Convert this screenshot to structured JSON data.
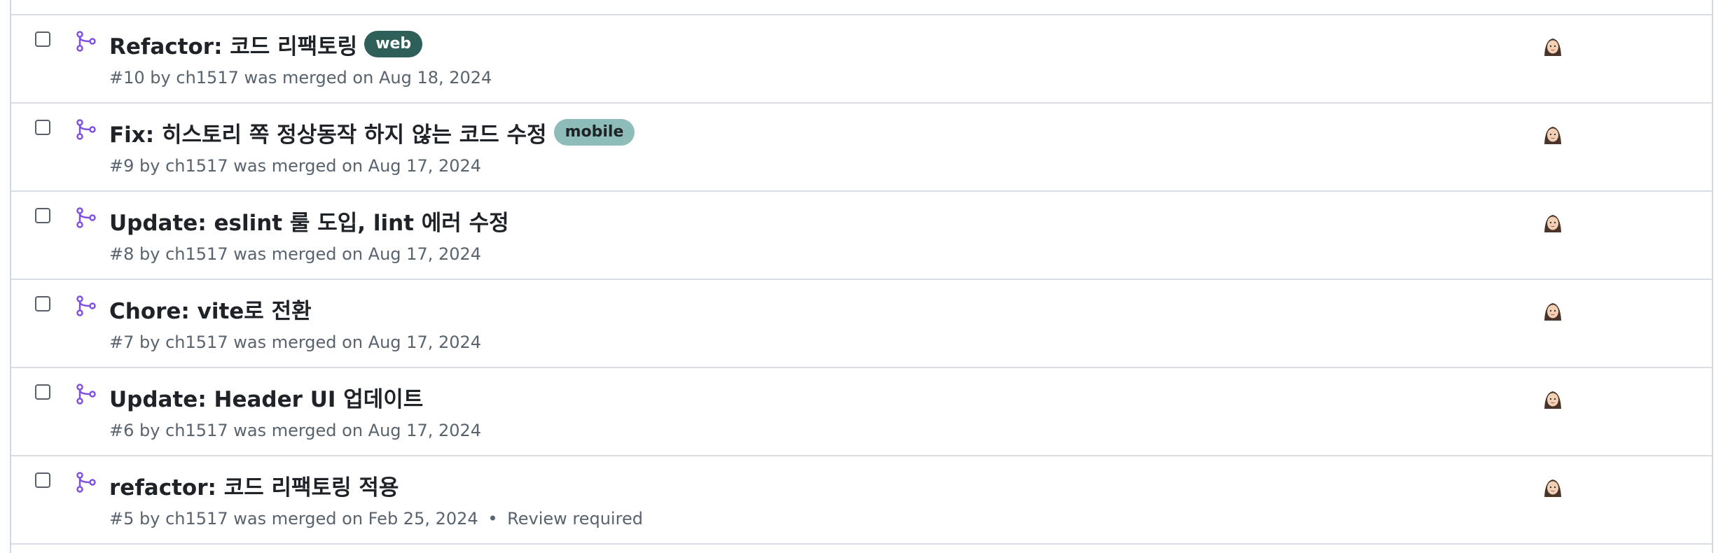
{
  "colors": {
    "accent_merged": "#8250df",
    "meta_text": "#59636e",
    "border": "#d8dee4"
  },
  "pull_requests": [
    {
      "title": "Refactor: 코드 리팩토링",
      "label": {
        "text": "web",
        "bg": "#2e5f59",
        "fg": "#ffffff"
      },
      "number": "#10",
      "by": "by",
      "author": "ch1517",
      "status": "was merged on Aug 18, 2024",
      "extra": ""
    },
    {
      "title": "Fix: 히스토리 쪽 정상동작 하지 않는 코드 수정",
      "label": {
        "text": "mobile",
        "bg": "#8dbcb9",
        "fg": "#1f2328"
      },
      "number": "#9",
      "by": "by",
      "author": "ch1517",
      "status": "was merged on Aug 17, 2024",
      "extra": ""
    },
    {
      "title": "Update: eslint 룰 도입, lint 에러 수정",
      "label": null,
      "number": "#8",
      "by": "by",
      "author": "ch1517",
      "status": "was merged on Aug 17, 2024",
      "extra": ""
    },
    {
      "title": "Chore: vite로 전환",
      "label": null,
      "number": "#7",
      "by": "by",
      "author": "ch1517",
      "status": "was merged on Aug 17, 2024",
      "extra": ""
    },
    {
      "title": "Update: Header UI 업데이트",
      "label": null,
      "number": "#6",
      "by": "by",
      "author": "ch1517",
      "status": "was merged on Aug 17, 2024",
      "extra": ""
    },
    {
      "title": "refactor: 코드 리팩토링 적용",
      "label": null,
      "number": "#5",
      "by": "by",
      "author": "ch1517",
      "status": "was merged on Feb 25, 2024",
      "extra": "Review required"
    }
  ],
  "icons": {
    "merged": "git-merge-icon",
    "avatar": "user-avatar"
  }
}
